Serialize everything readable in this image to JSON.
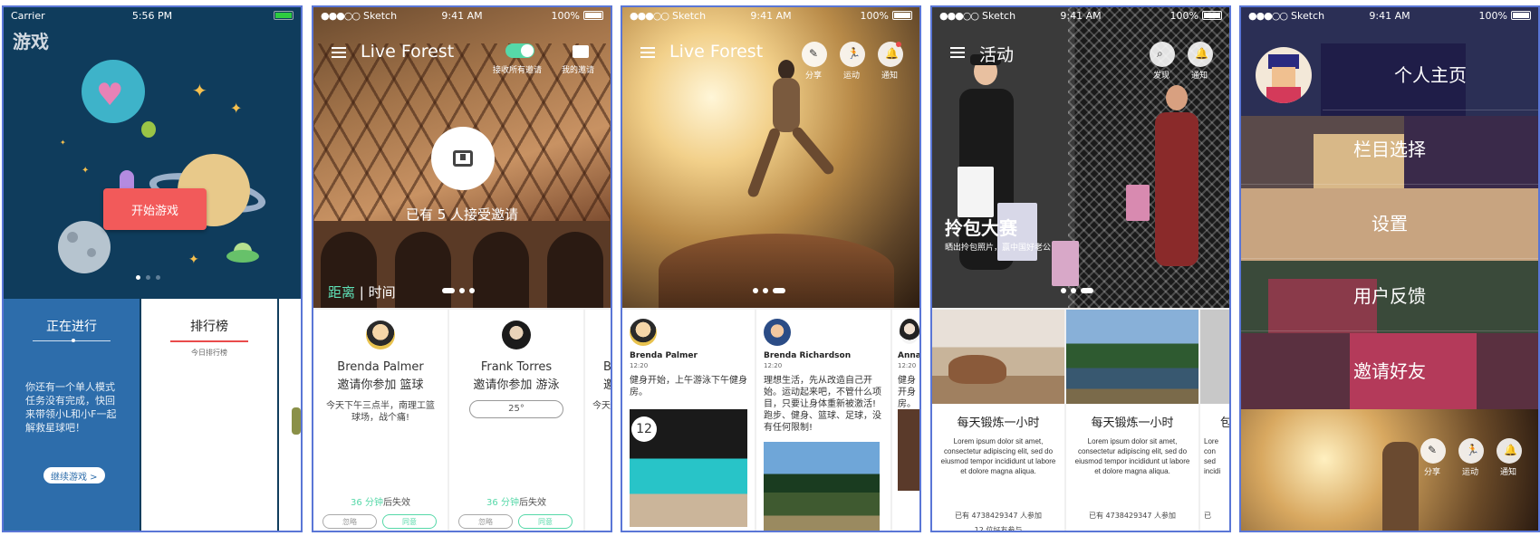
{
  "screens": {
    "game": {
      "status": {
        "carrier": "Carrier",
        "time": "5:56 PM"
      },
      "title": "游戏",
      "start_label": "开始游戏",
      "ongoing": {
        "title": "正在进行",
        "desc": "你还有一个单人模式任务没有完成，快回来带领小L和小F一起解救星球吧！",
        "continue_label": "继续游戏 >"
      },
      "ranking": {
        "title": "排行榜",
        "subtitle": "今日排行榜"
      }
    },
    "invites": {
      "status": {
        "carrier": "Sketch",
        "time": "9:41 AM",
        "battery": "100%"
      },
      "nav_title": "Live Forest",
      "receive_all_label": "接收所有邀请",
      "my_invites_label": "我的邀请",
      "accepted_text": "已有 5 人接受邀请",
      "sort": {
        "active": "距离",
        "separator": "|",
        "inactive": "时间"
      },
      "cards": [
        {
          "name": "Brenda Palmer",
          "invite": "邀请你参加 篮球",
          "message": "今天下午三点半，南理工篮球场，战个痛!",
          "expire_num": "36 分钟",
          "expire_suffix": "后失效",
          "ignore_label": "忽略",
          "accept_label": "同意"
        },
        {
          "name": "Frank Torres",
          "invite": "邀请你参加 游泳",
          "temperature": "25°",
          "expire_num": "36 分钟",
          "expire_suffix": "后失效",
          "ignore_label": "忽略",
          "accept_label": "同意"
        },
        {
          "name_partial": "Br",
          "invite_partial": "邀",
          "message_partial": "今天"
        }
      ]
    },
    "feed": {
      "status": {
        "carrier": "Sketch",
        "time": "9:41 AM",
        "battery": "100%"
      },
      "nav_title": "Live Forest",
      "actions": [
        {
          "label": "分享",
          "icon": "pencil-icon"
        },
        {
          "label": "运动",
          "icon": "runner-icon"
        },
        {
          "label": "通知",
          "icon": "bell-icon"
        }
      ],
      "posts": [
        {
          "name": "Brenda Palmer",
          "time": "12:20",
          "text": "健身开始，上午游泳下午健身房。",
          "badge": "12"
        },
        {
          "name": "Brenda Richardson",
          "time": "12:20",
          "text": "理想生活，先从改造自己开始。运动起来吧，不管什么项目，只要让身体重新被激活! 跑步、健身、篮球、足球，没有任何限制!"
        },
        {
          "name_partial": "Anna",
          "time": "12:20",
          "text_partial": "健身开身房。"
        }
      ]
    },
    "events": {
      "status": {
        "carrier": "Sketch",
        "time": "9:41 AM",
        "battery": "100%"
      },
      "nav_title": "活动",
      "actions": [
        {
          "label": "发现",
          "icon": "search-icon"
        },
        {
          "label": "通知",
          "icon": "bell-icon"
        }
      ],
      "banner_title": "拎包大赛",
      "banner_sub": "晒出拎包照片，赢中国好老公",
      "cards": [
        {
          "title": "每天锻炼一小时",
          "lorem": "Lorem ipsum dolor sit amet, consectetur adipiscing elit, sed do eiusmod tempor incididunt ut labore et dolore magna aliqua.",
          "join": "已有 4738429347 人参加",
          "friends": "12 位好友参与"
        },
        {
          "title": "每天锻炼一小时",
          "lorem": "Lorem ipsum dolor sit amet, consectetur adipiscing elit, sed do eiusmod tempor incididunt ut labore et dolore magna aliqua.",
          "join": "已有 4738429347 人参加"
        },
        {
          "title_partial": "包",
          "lorem_partial": "Lore con sed incidi",
          "join_partial": "已"
        }
      ]
    },
    "menu": {
      "status": {
        "carrier": "Sketch",
        "time": "9:41 AM",
        "battery": "100%"
      },
      "items": [
        "个人主页",
        "栏目选择",
        "设置",
        "用户反馈",
        "邀请好友"
      ],
      "actions": [
        {
          "label": "分享",
          "icon": "pencil-icon"
        },
        {
          "label": "运动",
          "icon": "runner-icon"
        },
        {
          "label": "通知",
          "icon": "bell-icon"
        }
      ]
    }
  },
  "colors": {
    "accent_green": "#56d8a8",
    "start_button": "#f25a5a",
    "ongoing_card": "#2d6dab",
    "ranking_underline": "#e94b4b",
    "frame_border": "#5a76d6"
  }
}
